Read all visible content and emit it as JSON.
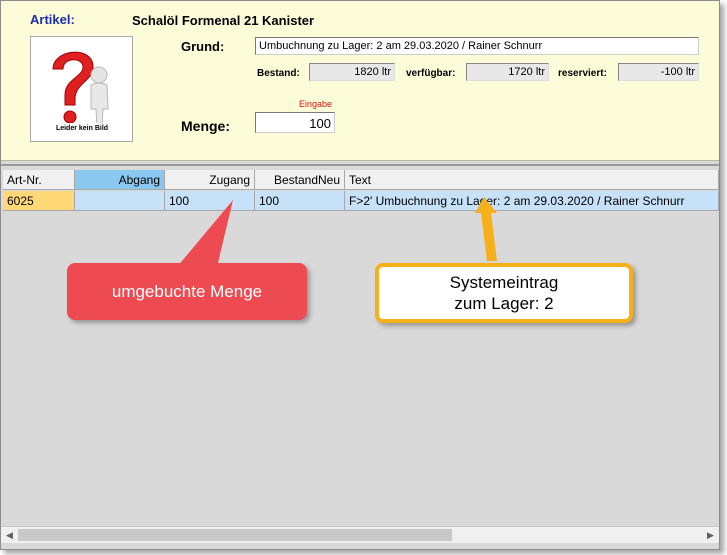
{
  "header": {
    "artikel_label": "Artikel:",
    "artikel_name": "Schalöl Formenal 21 Kanister",
    "image_caption": "Leider kein Bild",
    "grund_label": "Grund:",
    "grund_value": "Umbuchnung zu Lager: 2 am 29.03.2020 /  Rainer Schnurr",
    "bestand_label": "Bestand:",
    "bestand_value": "1820 ltr",
    "verfuegbar_label": "verfügbar:",
    "verfuegbar_value": "1720 ltr",
    "reserviert_label": "reserviert:",
    "reserviert_value": "-100 ltr",
    "eingabe_label": "Eingabe",
    "menge_label": "Menge:",
    "menge_value": "100"
  },
  "grid": {
    "columns": [
      "Art-Nr.",
      "Abgang",
      "Zugang",
      "BestandNeu",
      "Text"
    ],
    "row": {
      "art_nr": "6025",
      "abgang": "",
      "zugang": "100",
      "bestand_neu": "100",
      "text": "F>2' Umbuchnung zu Lager: 2 am 29.03.2020 /  Rainer Schnurr"
    }
  },
  "annotations": {
    "red": "umgebuchte Menge",
    "yellow_line1": "Systemeintrag",
    "yellow_line2": "zum Lager: 2"
  },
  "colors": {
    "header_bg": "#fdfcd8",
    "label_blue": "#1a2fb0",
    "row_highlight": "#c6e1f8",
    "artnr_cell": "#ffd878",
    "selected_header": "#8bc8f0",
    "callout_red": "#ee4a52",
    "callout_orange": "#f5b01a"
  },
  "icons": {
    "article_image": "question-mark-figure-icon",
    "scroll_left": "left-arrow-icon",
    "scroll_right": "right-arrow-icon"
  }
}
